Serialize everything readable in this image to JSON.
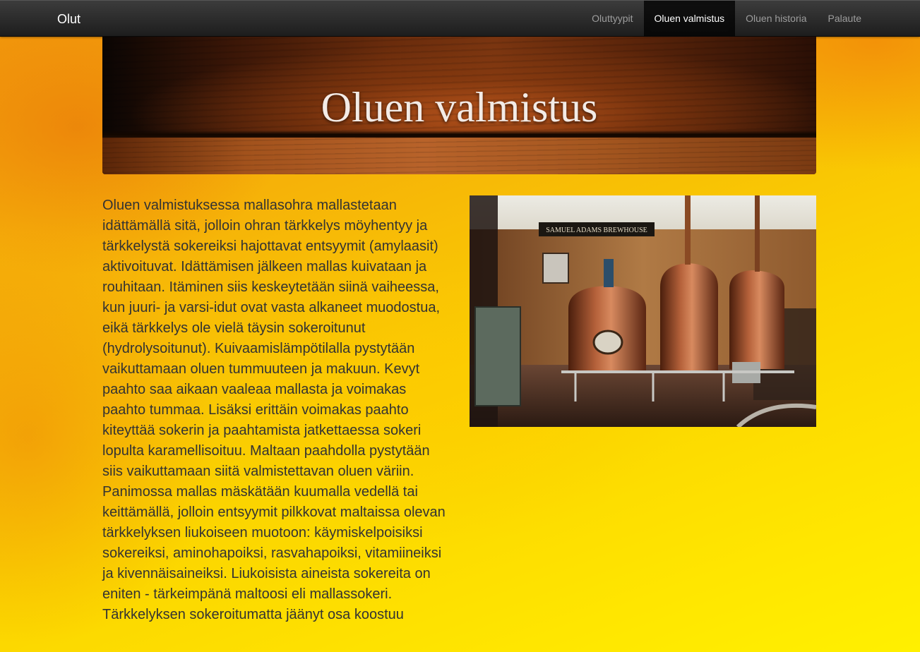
{
  "navbar": {
    "brand": "Olut",
    "items": [
      {
        "label": "Oluttyypit",
        "active": false
      },
      {
        "label": "Oluen valmistus",
        "active": true
      },
      {
        "label": "Oluen historia",
        "active": false
      },
      {
        "label": "Palaute",
        "active": false
      }
    ]
  },
  "header": {
    "title": "Oluen valmistus"
  },
  "main": {
    "text": "Oluen valmistuksessa mallasohra mallastetaan idättämällä sitä, jolloin ohran tärkkelys möyhentyy ja tärkkelystä sokereiksi hajottavat entsyymit (amylaasit) aktivoituvat. Idättämisen jälkeen mallas kuivataan ja rouhitaan. Itäminen siis keskeytetään siinä vaiheessa, kun juuri- ja varsi-idut ovat vasta alkaneet muodostua, eikä tärkkelys ole vielä täysin sokeroitunut (hydrolysoitunut). Kuivaamislämpötilalla pystytään vaikuttamaan oluen tummuuteen ja makuun. Kevyt paahto saa aikaan vaaleaa mallasta ja voimakas paahto tummaa. Lisäksi erittäin voimakas paahto kiteyttää sokerin ja paahtamista jatkettaessa sokeri lopulta karamellisoituu. Maltaan paahdolla pystytään siis vaikuttamaan siitä valmistettavan oluen väriin. Panimossa mallas mäskätään kuumalla vedellä tai keittämällä, jolloin entsyymit pilkkovat maltaissa olevan tärkkelyksen liukoiseen muotoon: käymiskelpoisiksi sokereiksi, aminohapoiksi, rasvahapoiksi, vitamiineiksi ja kivennäisaineiksi. Liukoisista aineista sokereita on eniten - tärkeimpänä maltoosi eli mallassokeri. Tärkkelyksen sokeroitumatta jäänyt osa koostuu",
    "photo_sign": "SAMUEL ADAMS BREWHOUSE"
  },
  "colors": {
    "navbar": "#222222",
    "nav_text": "#9d9d9d",
    "nav_active_bg": "#080808",
    "title_text": "#f3ebe6",
    "body_text": "#333333",
    "background_top": "#f39a0c",
    "background_bottom": "#fff000"
  }
}
